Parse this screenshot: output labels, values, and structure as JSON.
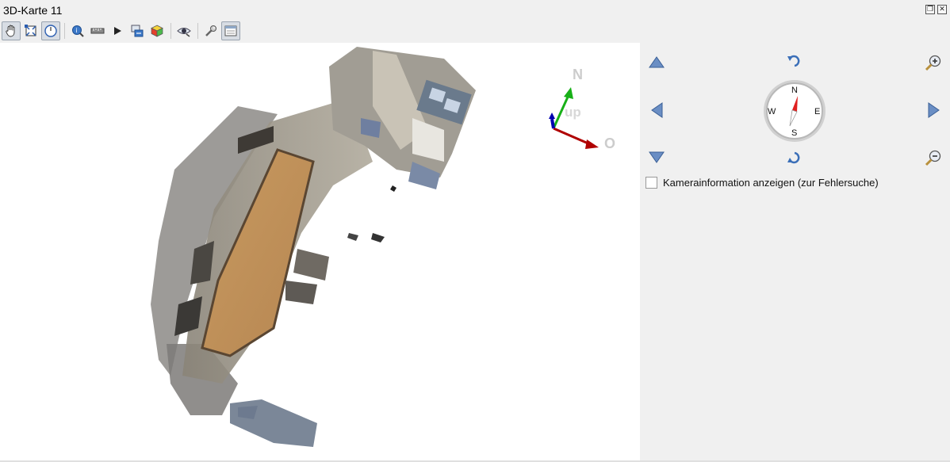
{
  "window": {
    "title": "3D-Karte 11",
    "float_button": "❐",
    "close_button": "✕"
  },
  "toolbar": {
    "tools": [
      {
        "name": "pan",
        "icon": "hand-icon",
        "active": true
      },
      {
        "name": "zoom-full",
        "icon": "zoom-full-icon",
        "active": false
      },
      {
        "name": "camera-control",
        "icon": "camera-orbit-icon",
        "active": true
      },
      {
        "name": "identify",
        "icon": "identify-icon",
        "active": false
      },
      {
        "name": "measure",
        "icon": "measure-icon",
        "active": false
      },
      {
        "name": "animation",
        "icon": "play-icon",
        "active": false
      },
      {
        "name": "export-scene",
        "icon": "export-icon",
        "active": false
      },
      {
        "name": "effects",
        "icon": "cube-icon",
        "active": false
      },
      {
        "name": "camera-view",
        "icon": "eye-icon",
        "active": false
      },
      {
        "name": "configure",
        "icon": "wrench-icon",
        "active": false
      },
      {
        "name": "toggle-nav-panel",
        "icon": "panel-icon",
        "active": true
      }
    ]
  },
  "axis_gizmo": {
    "north_label": "N",
    "up_label": "up",
    "east_label": "O"
  },
  "compass": {
    "n": "N",
    "e": "E",
    "s": "S",
    "w": "W"
  },
  "navigation": {
    "camera_info_label": "Kamerainformation anzeigen (zur Fehlersuche)",
    "camera_info_checked": false
  },
  "colors": {
    "accent": "#4a76b8",
    "compass_needle": "#e02020",
    "axis_x": "#b00000",
    "axis_y": "#18b018",
    "axis_z": "#0000b0"
  }
}
